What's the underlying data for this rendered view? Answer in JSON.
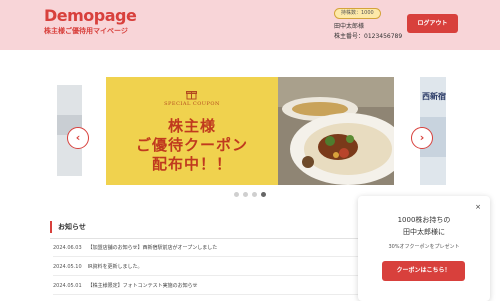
{
  "header": {
    "logo_text": "Demopage",
    "logo_subtitle": "株主様ご優待用マイページ",
    "shares_badge": "持株数：1000",
    "user_name": "田中太郎様",
    "holder_number": "株主番号：0123456789",
    "logout_label": "ログアウト"
  },
  "carousel": {
    "next_slide_text": "西新宿",
    "banner": {
      "coupon_label": "SPECIAL COUPON",
      "line1": "株主様",
      "line2": "ご優待クーポン",
      "line3": "配布中！！"
    },
    "prev_glyph": "‹",
    "next_glyph": "›",
    "slide_count": 4,
    "active_slide": 4
  },
  "news": {
    "title": "お知らせ",
    "items": [
      {
        "date": "2024.06.03",
        "text": "【加盟店舗のお知らせ】西新宿駅前店がオープンしました"
      },
      {
        "date": "2024.05.10",
        "text": "IR資料を更新しました。"
      },
      {
        "date": "2024.05.01",
        "text": "【株主様限定】フォトコンテスト実施のお知らせ"
      }
    ]
  },
  "popup": {
    "line1": "1000株お持ちの",
    "line2": "田中太郎様に",
    "note": "30%オフクーポンをプレゼント",
    "button_label": "クーポンはこちら！",
    "close_glyph": "×"
  },
  "colors": {
    "brand": "#d8403c",
    "header_bg": "#f8d5d8",
    "banner_yellow": "#f0d24e"
  }
}
